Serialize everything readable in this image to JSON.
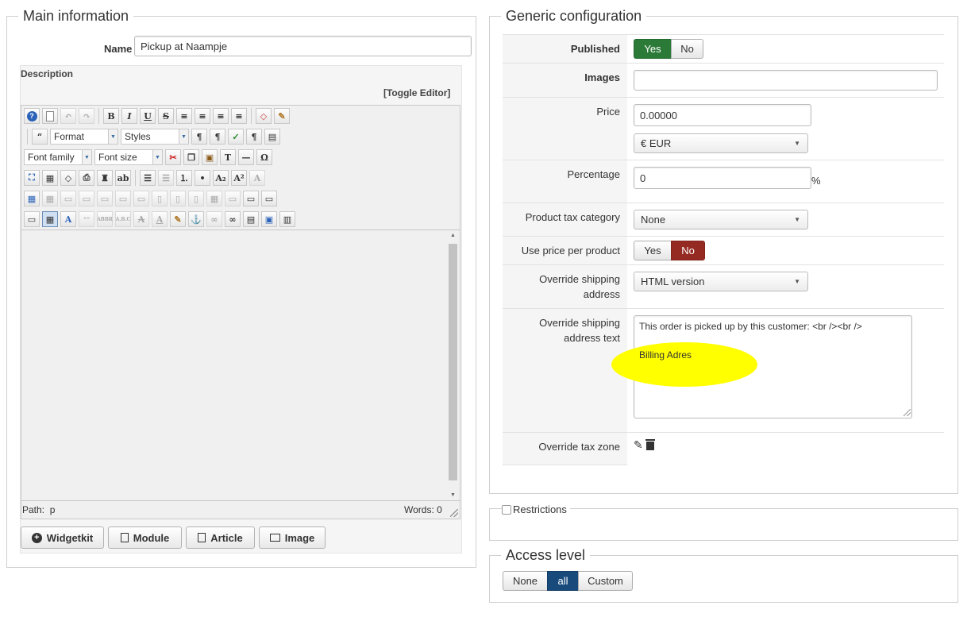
{
  "main": {
    "legend": "Main information",
    "name_label": "Name",
    "name_value": "Pickup at Naampje",
    "description_label": "Description",
    "toggle_editor": "[Toggle Editor]",
    "toolbar": {
      "format": "Format",
      "styles": "Styles",
      "font_family": "Font family",
      "font_size": "Font size"
    },
    "path_label": "Path:",
    "path_value": "p",
    "words": "Words: 0",
    "buttons": [
      "Widgetkit",
      "Module",
      "Article",
      "Image"
    ]
  },
  "generic": {
    "legend": "Generic configuration",
    "published_label": "Published",
    "published_yes": "Yes",
    "published_no": "No",
    "images_label": "Images",
    "images_value": "",
    "price_label": "Price",
    "price_value": "0.00000",
    "currency": "€ EUR",
    "percentage_label": "Percentage",
    "percentage_value": "0",
    "percent_sign": "%",
    "tax_category_label": "Product tax category",
    "tax_category_value": "None",
    "use_price_label": "Use price per product",
    "use_price_yes": "Yes",
    "use_price_no": "No",
    "override_address_label_1": "Override shipping",
    "override_address_label_2": "address",
    "override_address_value": "HTML version",
    "override_text_label_1": "Override shipping",
    "override_text_label_2": "address text",
    "override_text_line1": "This order is picked up by this customer: <br /><br />",
    "override_text_line2": "Billing Adres",
    "tax_zone_label": "Override tax zone"
  },
  "restrictions": {
    "label": "Restrictions"
  },
  "access": {
    "legend": "Access level",
    "options": [
      "None",
      "all",
      "Custom"
    ],
    "selected": "all"
  },
  "colors": {
    "green": "#2b7a38",
    "red": "#952a22",
    "blue": "#184b7c",
    "highlight": "#ffff00"
  }
}
